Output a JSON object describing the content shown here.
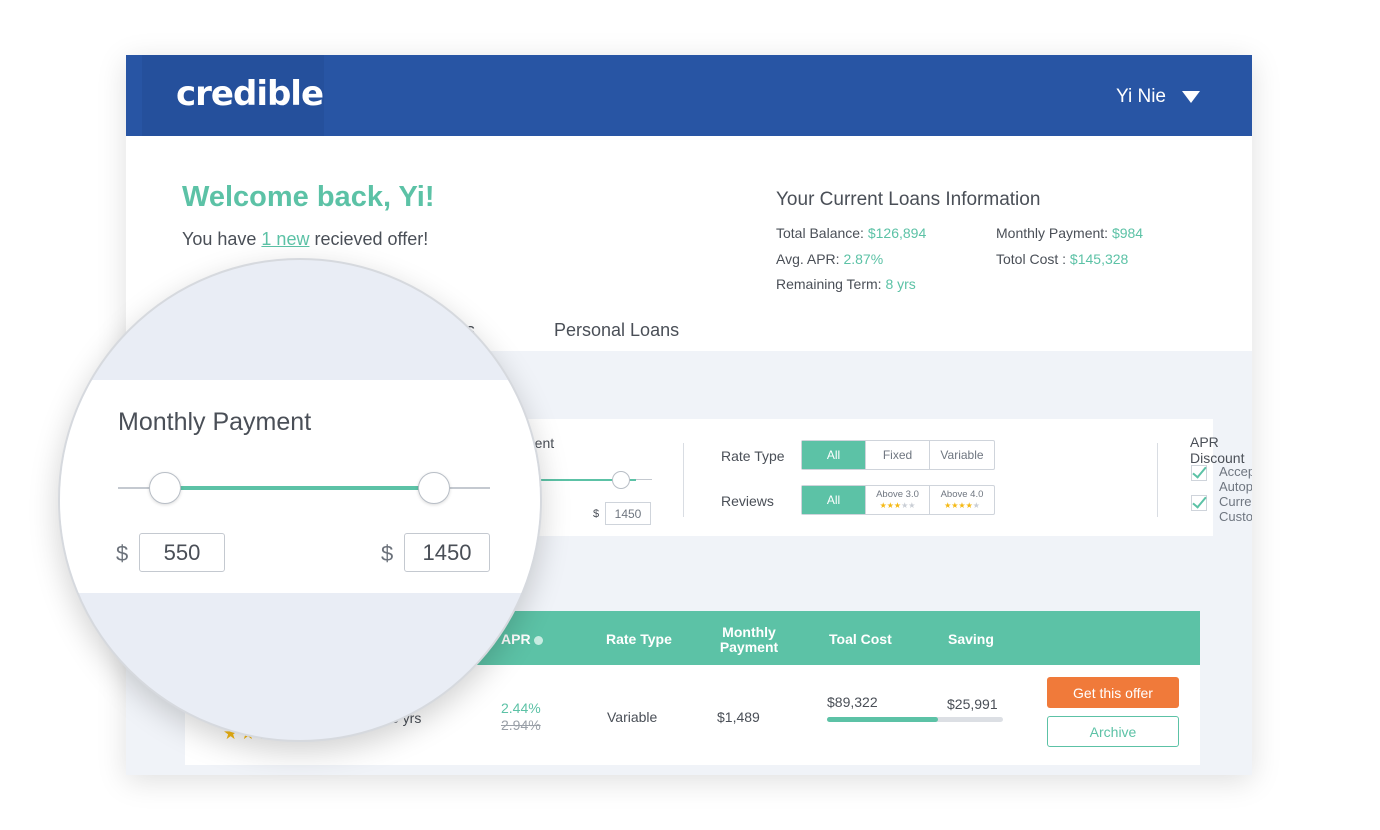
{
  "topbar": {
    "logo": "credible",
    "user": "Yi Nie"
  },
  "welcome": {
    "title": "Welcome back, Yi!",
    "offer_prefix": "You have ",
    "offer_link": "1 new",
    "offer_suffix": " recieved offer!"
  },
  "loans": {
    "title": "Your Current Loans Information",
    "total_balance_label": "Total Balance:",
    "total_balance": "$126,894",
    "monthly_payment_label": "Monthly Payment:",
    "monthly_payment": "$984",
    "avg_apr_label": "Avg. APR:",
    "avg_apr": "2.87%",
    "total_cost_label": "Totol Cost :",
    "total_cost": "$145,328",
    "remaining_term_label": "Remaining Term:",
    "remaining_term": "8 yrs"
  },
  "tabs": {
    "partial": "ns",
    "personal": "Personal Loans"
  },
  "filters": {
    "monthly_partial": "ment",
    "max_prefix": "$",
    "max_value": "1450",
    "rate_type_label": "Rate Type",
    "rate_options": [
      "All",
      "Fixed",
      "Variable"
    ],
    "reviews_label": "Reviews",
    "review_options": [
      "All",
      "Above 3.0",
      "Above 4.0"
    ],
    "apr_discount_label": "APR Discount",
    "accept_autopay": "Accept Autopay",
    "current_customer": "Current Customer"
  },
  "table": {
    "headers": {
      "apr": "APR",
      "rate_type": "Rate Type",
      "monthly": "Monthly Payment",
      "total_cost": "Toal Cost",
      "saving": "Saving"
    },
    "row": {
      "term": "5 yrs",
      "apr_new": "2.44%",
      "apr_old": "2.94%",
      "rate_type": "Variable",
      "monthly": "$1,489",
      "total_cost": "$89,322",
      "saving": "$25,991",
      "cost_bar_fraction": 0.63,
      "rating": 4,
      "offer_button": "Get this offer",
      "archive_button": "Archive"
    }
  },
  "magnifier": {
    "title": "Monthly Payment",
    "min_prefix": "$",
    "min_value": "550",
    "max_prefix": "$",
    "max_value": "1450"
  },
  "colors": {
    "brand_blue": "#2855a4",
    "accent_green": "#5cc2a6",
    "offer_orange": "#f07a3a",
    "star_gold": "#f5b914"
  }
}
